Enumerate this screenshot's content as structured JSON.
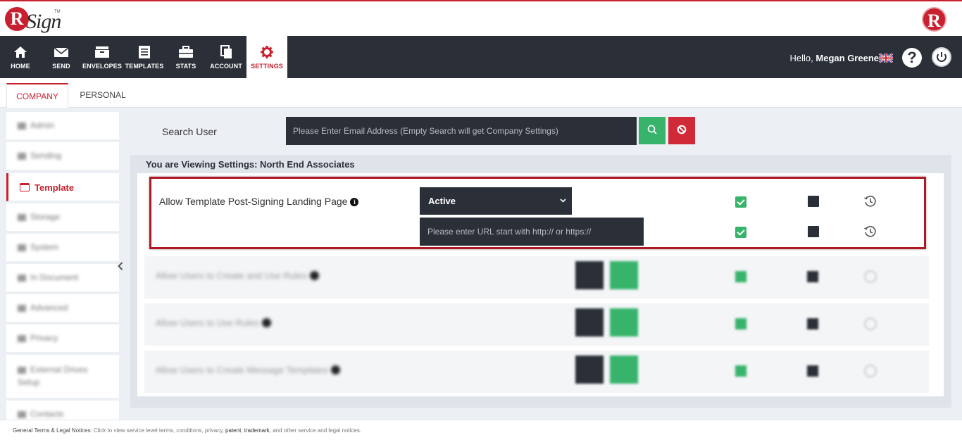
{
  "brand": {
    "name": "RSign",
    "logo_letter": "R",
    "logo_rest": "Sign",
    "tm": "TM"
  },
  "nav": {
    "items": [
      {
        "label": "HOME",
        "icon": "home-icon"
      },
      {
        "label": "SEND",
        "icon": "envelope-icon"
      },
      {
        "label": "ENVELOPES",
        "icon": "inbox-icon"
      },
      {
        "label": "TEMPLATES",
        "icon": "templates-icon"
      },
      {
        "label": "STATS",
        "icon": "briefcase-icon"
      },
      {
        "label": "ACCOUNT",
        "icon": "account-icon"
      },
      {
        "label": "SETTINGS",
        "icon": "gear-icon",
        "active": true
      }
    ],
    "hello": "Hello,",
    "user_name": "Megan Greene",
    "help_label": "?"
  },
  "tabs": [
    {
      "label": "COMPANY",
      "active": true
    },
    {
      "label": "PERSONAL",
      "active": false
    }
  ],
  "sidebar": {
    "items": [
      {
        "label": "Admin",
        "blurred": true
      },
      {
        "label": "Sending",
        "blurred": true
      },
      {
        "label": "Template",
        "active": true
      },
      {
        "label": "Storage",
        "blurred": true
      },
      {
        "label": "System",
        "blurred": true
      },
      {
        "label": "In Document",
        "blurred": true
      },
      {
        "label": "Advanced",
        "blurred": true
      },
      {
        "label": "Privacy",
        "blurred": true
      },
      {
        "label": "External Drives Setup",
        "blurred": true
      },
      {
        "label": "Contacts",
        "blurred": true
      }
    ]
  },
  "search": {
    "label": "Search User",
    "placeholder": "Please Enter Email Address (Empty Search will get Company Settings)",
    "value": ""
  },
  "viewing_text": "You are Viewing Settings: North End Associates",
  "setting": {
    "label": "Allow Template Post-Signing Landing Page",
    "select_value": "Active",
    "url_placeholder": "Please enter URL start with http:// or https://",
    "url_value": ""
  },
  "blurred_rows": [
    {
      "label": "Allow Users to Create and Use Rules"
    },
    {
      "label": "Allow Users to Use Rules"
    },
    {
      "label": "Allow Users to Create Message Templates"
    }
  ],
  "footer": {
    "title": "General Terms & Legal Notices:",
    "text_before": " Click to view service level terms, conditions, privacy, ",
    "patent": "patent",
    "sep": ", ",
    "trademark": "trademark",
    "text_after": ", and other service and legal notices."
  },
  "colors": {
    "accent": "#c8202f",
    "nav_bg": "#2a2f38",
    "green": "#37b36b",
    "red_btn": "#d02a38"
  }
}
